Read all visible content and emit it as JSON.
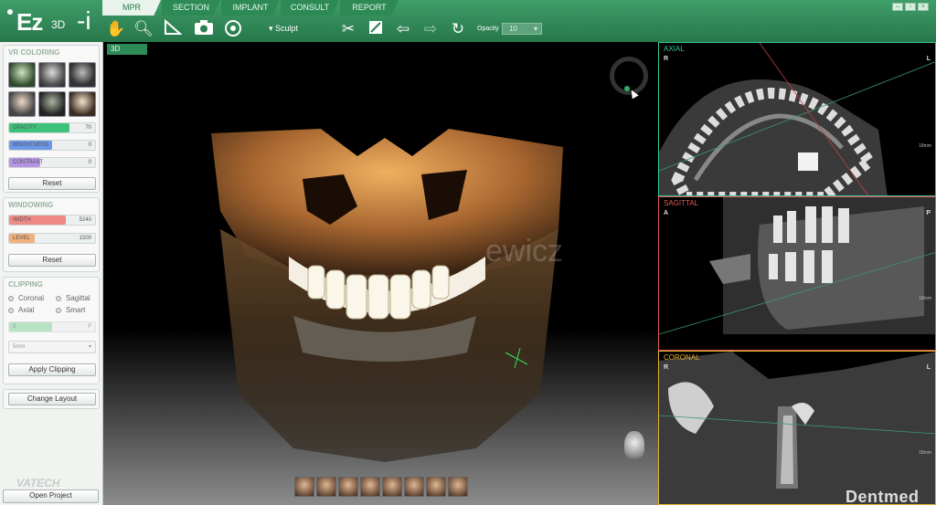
{
  "app": {
    "logo_main": "Ez",
    "logo_sub": "3D",
    "logo_suffix": "-i"
  },
  "tabs": [
    {
      "label": "MPR",
      "active": true
    },
    {
      "label": "SECTION"
    },
    {
      "label": "IMPLANT"
    },
    {
      "label": "CONSULT"
    },
    {
      "label": "REPORT"
    }
  ],
  "toolbar": {
    "tools": [
      "hand-icon",
      "magnifier-icon",
      "ruler-icon",
      "camera-icon",
      "capture-icon"
    ],
    "sculpt_label": "Sculpt",
    "tools2": [
      "scissors-icon",
      "eraser-icon",
      "undo-icon",
      "redo-icon",
      "reset-icon"
    ],
    "opacity_label": "Opacity",
    "opacity_value": "10"
  },
  "vr_coloring": {
    "title": "VR COLORING",
    "opacity": {
      "label": "OPACITY",
      "value": "70",
      "color": "#3ec27a"
    },
    "brightness": {
      "label": "BRIGHTNESS",
      "value": "0",
      "color": "#6d98e9"
    },
    "contrast": {
      "label": "CONTRAST",
      "value": "0",
      "color": "#b594e3"
    },
    "reset": "Reset"
  },
  "windowing": {
    "title": "WINDOWING",
    "width": {
      "label": "WIDTH",
      "value": "5240",
      "color": "#ee8a86"
    },
    "level": {
      "label": "LEVEL",
      "value": "1500",
      "color": "#efb17e"
    },
    "reset": "Reset"
  },
  "clipping": {
    "title": "CLIPPING",
    "options": [
      "Coronal",
      "Sagittal",
      "Axial",
      "Smart"
    ],
    "slider_min": "0",
    "slider_end": "F",
    "thickness": "5mm",
    "apply": "Apply Clipping"
  },
  "change_layout": "Change Layout",
  "brand": "VATECH",
  "open_project": "Open Project",
  "view3d": {
    "tag": "3D",
    "watermark": "ewicz"
  },
  "slices": [
    {
      "name": "AXIAL",
      "color": "#35c59a",
      "left": "R",
      "right": "L",
      "scale": "18mm"
    },
    {
      "name": "SAGITTAL",
      "color": "#e35a5a",
      "left": "A",
      "right": "P",
      "scale": "18mm"
    },
    {
      "name": "CORONAL",
      "color": "#e2b12e",
      "left": "R",
      "right": "L",
      "scale": "18mm"
    }
  ],
  "footer_brand": "Dentmed"
}
